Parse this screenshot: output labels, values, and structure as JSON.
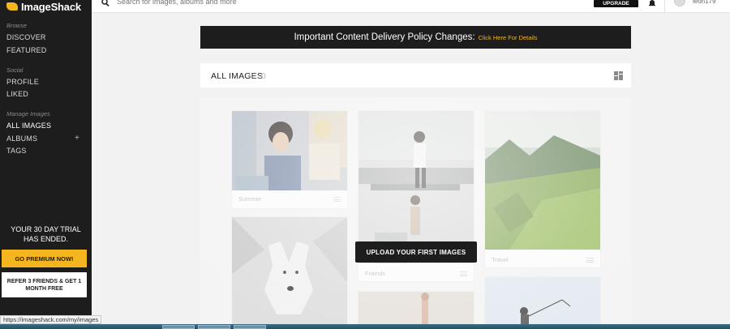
{
  "app": {
    "name": "ImageShack"
  },
  "sidebar": {
    "sections": [
      {
        "label": "Browse",
        "items": [
          "DISCOVER",
          "FEATURED"
        ]
      },
      {
        "label": "Social",
        "items": [
          "PROFILE",
          "LIKED"
        ]
      },
      {
        "label": "Manage Images",
        "items": [
          "ALL IMAGES",
          "ALBUMS",
          "TAGS"
        ]
      }
    ],
    "albums_add": "+",
    "trial_line1": "YOUR 30 DAY TRIAL",
    "trial_line2": "HAS ENDED.",
    "premium_label": "GO PREMIUM NOW!",
    "refer_label": "REFER 3 FRIENDS & GET 1 MONTH FREE"
  },
  "topbar": {
    "search_placeholder": "Search for images, albums and more",
    "upgrade_label": "UPGRADE",
    "username": "leon179"
  },
  "banner": {
    "title": "Important Content Delivery Policy Changes:",
    "link": "Click Here For Details"
  },
  "images": {
    "title": "ALL IMAGES",
    "count": "0"
  },
  "cards": [
    {
      "caption": "Summer"
    },
    {
      "caption": "Friends"
    },
    {
      "caption": "Travel"
    }
  ],
  "upload_label": "UPLOAD YOUR FIRST IMAGES",
  "status_url": "https://imageshack.com/my/images",
  "colors": {
    "accent": "#f5b51f",
    "dark": "#1d1d1d"
  }
}
